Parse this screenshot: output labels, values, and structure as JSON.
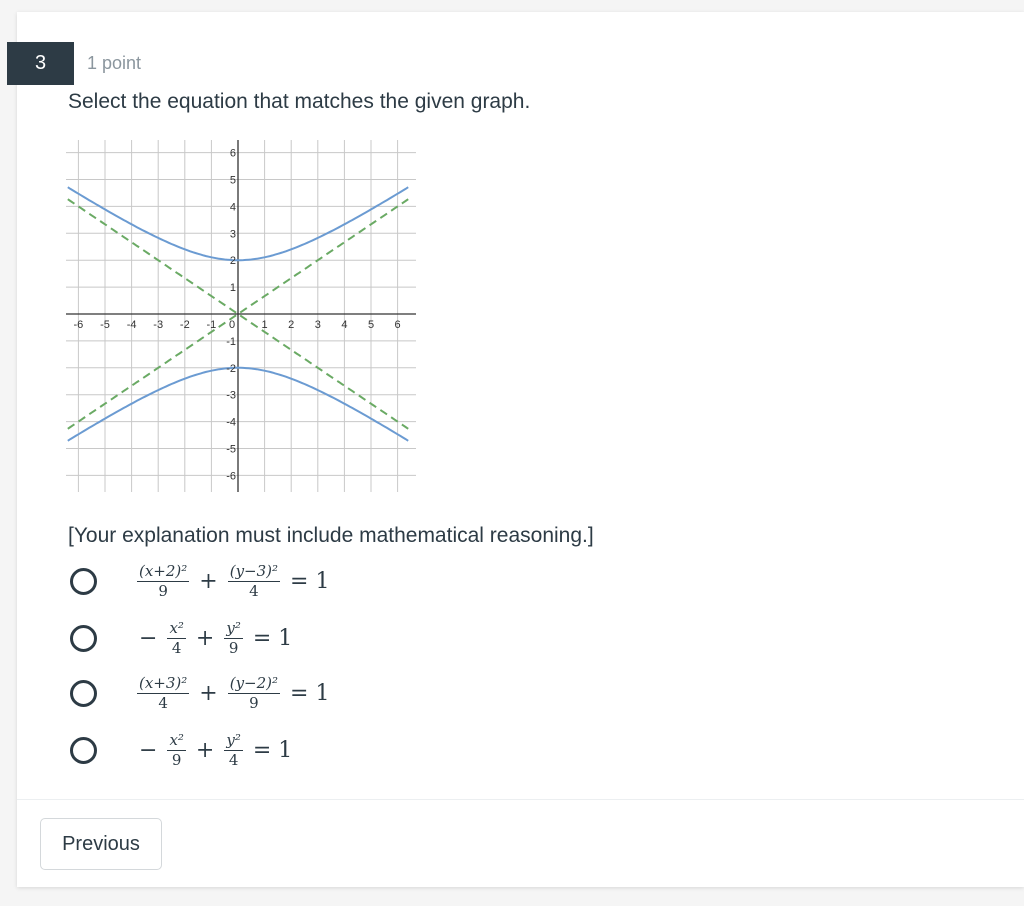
{
  "question": {
    "number": "3",
    "points": "1 point",
    "prompt": "Select the equation that matches the given graph.",
    "note": "[Your explanation must include mathematical reasoning.]"
  },
  "chart_data": {
    "type": "line",
    "title": "",
    "xlabel": "",
    "ylabel": "",
    "xlim": [
      -6.4,
      6.4
    ],
    "ylim": [
      -6.4,
      6.4
    ],
    "grid": true,
    "x_ticks": [
      "-6",
      "-5",
      "-4",
      "-3",
      "-2",
      "-1",
      "0",
      "1",
      "2",
      "3",
      "4",
      "5",
      "6"
    ],
    "y_ticks": [
      "6",
      "5",
      "4",
      "3",
      "2",
      "1",
      "-1",
      "-2",
      "-3",
      "-4",
      "-5",
      "-6"
    ],
    "series": [
      {
        "name": "hyperbola-upper",
        "equation": "y = 2*sqrt(1 + x^2/9)",
        "color": "#6b9bd2",
        "style": "solid"
      },
      {
        "name": "hyperbola-lower",
        "equation": "y = -2*sqrt(1 + x^2/9)",
        "color": "#6b9bd2",
        "style": "solid"
      },
      {
        "name": "asymptote-positive",
        "equation": "y = (2/3)x",
        "color": "#6aaa64",
        "style": "dashed"
      },
      {
        "name": "asymptote-negative",
        "equation": "y = -(2/3)x",
        "color": "#6aaa64",
        "style": "dashed"
      }
    ]
  },
  "options": [
    {
      "parts": [
        {
          "num": "(x+2)²",
          "den": "9"
        },
        "+",
        {
          "num": "(y−3)²",
          "den": "4"
        },
        "= 1"
      ]
    },
    {
      "parts": [
        "−",
        {
          "num": "x²",
          "den": "4"
        },
        "+",
        {
          "num": "y²",
          "den": "9"
        },
        "= 1"
      ]
    },
    {
      "parts": [
        {
          "num": "(x+3)²",
          "den": "4"
        },
        "+",
        {
          "num": "(y−2)²",
          "den": "9"
        },
        "= 1"
      ]
    },
    {
      "parts": [
        "−",
        {
          "num": "x²",
          "den": "9"
        },
        "+",
        {
          "num": "y²",
          "den": "4"
        },
        "= 1"
      ]
    }
  ],
  "footer": {
    "previous_label": "Previous"
  }
}
